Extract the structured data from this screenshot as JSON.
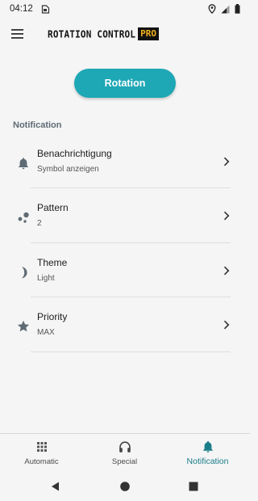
{
  "status_bar": {
    "time": "04:12",
    "icons": [
      "sim-card-icon",
      "location-icon",
      "signal-icon",
      "battery-icon"
    ]
  },
  "app_bar": {
    "menu_icon": "hamburger-menu-icon",
    "brand_text": "ROTATION CONTROL",
    "brand_badge": "PRO",
    "badge_color": "#f3b21b"
  },
  "main": {
    "rotation_button_label": "Rotation",
    "accent_color": "#1ea7b5",
    "section_title": "Notification",
    "items": [
      {
        "icon": "bell-icon",
        "title": "Benachrichtigung",
        "subtitle": "Symbol anzeigen"
      },
      {
        "icon": "pattern-dots-icon",
        "title": "Pattern",
        "subtitle": "2"
      },
      {
        "icon": "moon-icon",
        "title": "Theme",
        "subtitle": "Light"
      },
      {
        "icon": "star-icon",
        "title": "Priority",
        "subtitle": "MAX"
      }
    ]
  },
  "bottom_nav": {
    "items": [
      {
        "icon": "grid-icon",
        "label": "Automatic",
        "active": false
      },
      {
        "icon": "headphones-icon",
        "label": "Special",
        "active": false
      },
      {
        "icon": "bell-icon",
        "label": "Notification",
        "active": true
      }
    ],
    "active_color": "#1a7d8a"
  },
  "system_nav": [
    "back-icon",
    "home-icon",
    "recents-icon"
  ]
}
